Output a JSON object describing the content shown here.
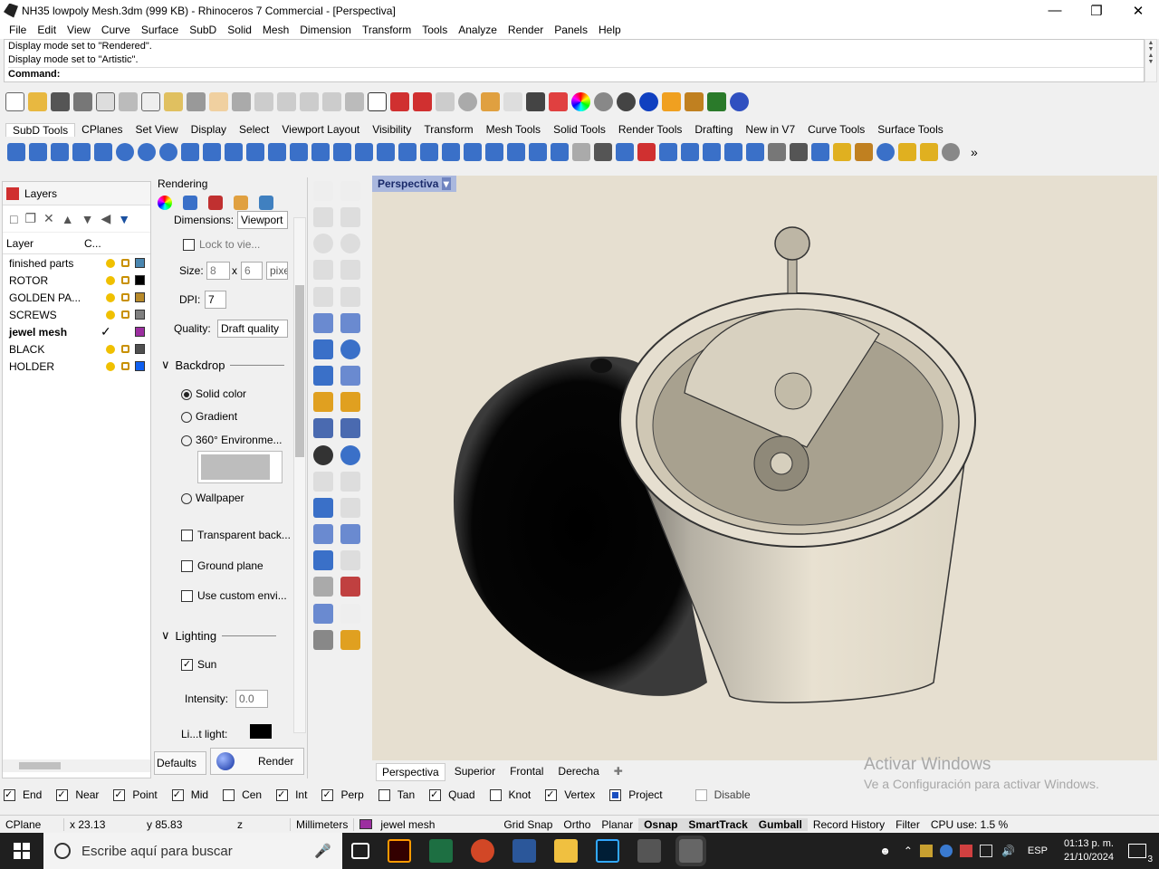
{
  "window": {
    "title": "NH35 lowpoly Mesh.3dm (999 KB) - Rhinoceros 7 Commercial - [Perspectiva]"
  },
  "menu": [
    "File",
    "Edit",
    "View",
    "Curve",
    "Surface",
    "SubD",
    "Solid",
    "Mesh",
    "Dimension",
    "Transform",
    "Tools",
    "Analyze",
    "Render",
    "Panels",
    "Help"
  ],
  "history": {
    "line1": "Display mode set to \"Rendered\".",
    "line2": "Display mode set to \"Artistic\".",
    "command_label": "Command:"
  },
  "tabs": [
    "SubD Tools",
    "CPlanes",
    "Set View",
    "Display",
    "Select",
    "Viewport Layout",
    "Visibility",
    "Transform",
    "Mesh Tools",
    "Solid Tools",
    "Render Tools",
    "Drafting",
    "New in V7",
    "Curve Tools",
    "Surface Tools"
  ],
  "layers_panel": {
    "title": "Layers",
    "col_layer": "Layer",
    "col_color": "C...",
    "rows": [
      {
        "name": "finished parts",
        "color": "#4a86b0",
        "current": false
      },
      {
        "name": "ROTOR",
        "color": "#000000",
        "current": false
      },
      {
        "name": "GOLDEN PA...",
        "color": "#b88a2a",
        "current": false
      },
      {
        "name": "SCREWS",
        "color": "#808080",
        "current": false
      },
      {
        "name": "jewel mesh",
        "color": "#9c2ea0",
        "current": true
      },
      {
        "name": "BLACK",
        "color": "#505050",
        "current": false
      },
      {
        "name": "HOLDER",
        "color": "#1060f0",
        "current": false
      }
    ]
  },
  "render_panel": {
    "title": "Rendering",
    "dimensions_label": "Dimensions:",
    "dimensions_value": "Viewport",
    "lock_label": "Lock to vie...",
    "size_label": "Size:",
    "size_w": "8",
    "size_x": "x",
    "size_h": "6",
    "size_unit": "pixe",
    "dpi_label": "DPI:",
    "dpi_value": "7",
    "quality_label": "Quality:",
    "quality_value": "Draft quality",
    "backdrop_title": "Backdrop",
    "opt_solid": "Solid color",
    "opt_gradient": "Gradient",
    "opt_360": "360° Environme...",
    "opt_wallpaper": "Wallpaper",
    "transparent": "Transparent back...",
    "ground": "Ground plane",
    "custom_env": "Use custom envi...",
    "lighting_title": "Lighting",
    "sun": "Sun",
    "intensity_label": "Intensity:",
    "intensity_value": "0.0",
    "light_label": "Li...t light:",
    "defaults_btn": "Defaults",
    "render_btn": "Render"
  },
  "viewport": {
    "label": "Perspectiva",
    "tabs": [
      "Perspectiva",
      "Superior",
      "Frontal",
      "Derecha"
    ]
  },
  "watermark": {
    "line1": "Activar Windows",
    "line2": "Ve a Configuración para activar Windows."
  },
  "osnaps": [
    {
      "label": "End",
      "on": true
    },
    {
      "label": "Near",
      "on": true
    },
    {
      "label": "Point",
      "on": true
    },
    {
      "label": "Mid",
      "on": true
    },
    {
      "label": "Cen",
      "on": false
    },
    {
      "label": "Int",
      "on": true
    },
    {
      "label": "Perp",
      "on": true
    },
    {
      "label": "Tan",
      "on": false
    },
    {
      "label": "Quad",
      "on": true
    },
    {
      "label": "Knot",
      "on": false
    },
    {
      "label": "Vertex",
      "on": true
    },
    {
      "label": "Project",
      "on": true
    },
    {
      "label": "Disable",
      "on": false
    }
  ],
  "status": {
    "cplane": "CPlane",
    "x": "x 23.13",
    "y": "y 85.83",
    "z": "z",
    "units": "Millimeters",
    "layer": "jewel mesh",
    "grid_snap": "Grid Snap",
    "ortho": "Ortho",
    "planar": "Planar",
    "osnap": "Osnap",
    "smarttrack": "SmartTrack",
    "gumball": "Gumball",
    "record_history": "Record History",
    "filter": "Filter",
    "cpu": "CPU use: 1.5 %"
  },
  "taskbar": {
    "search": "Escribe aquí para buscar",
    "lang": "ESP",
    "time": "01:13 p. m.",
    "date": "21/10/2024",
    "notif": "3"
  }
}
